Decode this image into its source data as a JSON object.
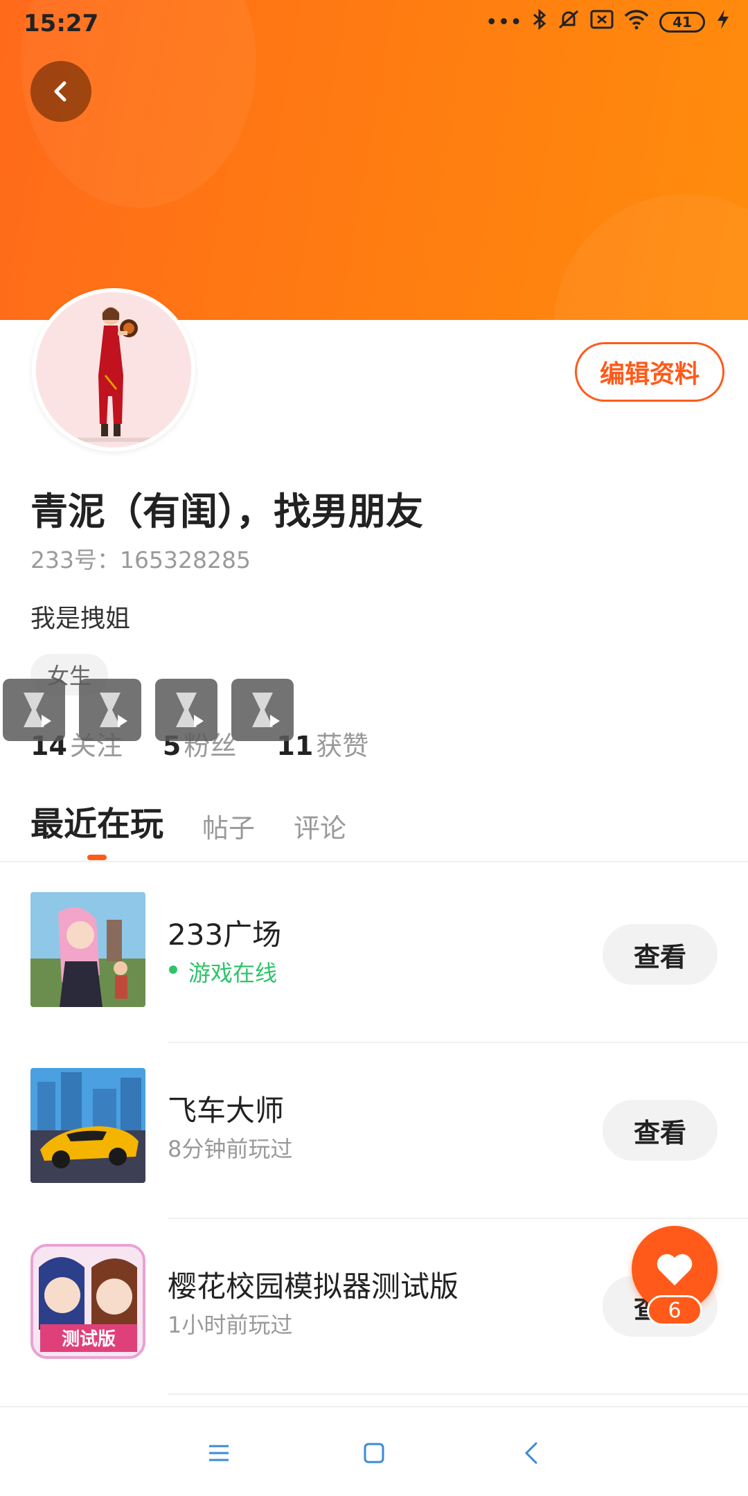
{
  "status_bar": {
    "time": "15:27",
    "battery": "41",
    "icons": [
      "more-dots-icon",
      "bluetooth-icon",
      "mute-icon",
      "sim-icon",
      "wifi-icon",
      "battery-icon",
      "charging-icon"
    ]
  },
  "profile": {
    "edit_label": "编辑资料",
    "nickname": "青泥（有闺），找男朋友",
    "id_text": "233号：165328285",
    "bio": "我是拽姐",
    "tag": "女生",
    "stats": [
      {
        "num": "14",
        "label": "关注"
      },
      {
        "num": "5",
        "label": "粉丝"
      },
      {
        "num": "11",
        "label": "获赞"
      }
    ]
  },
  "tabs": [
    {
      "label": "最近在玩",
      "active": true
    },
    {
      "label": "帖子",
      "active": false
    },
    {
      "label": "评论",
      "active": false
    }
  ],
  "games": [
    {
      "name": "233广场",
      "sub": "游戏在线",
      "online": true,
      "button": "查看"
    },
    {
      "name": "飞车大师",
      "sub": "8分钟前玩过",
      "online": false,
      "button": "查看"
    },
    {
      "name": "樱花校园模拟器测试版",
      "sub": "1小时前玩过",
      "online": false,
      "button": "查看",
      "thumb_badge": "测试版"
    }
  ],
  "like": {
    "count": "6"
  },
  "colors": {
    "accent": "#ff5a1a",
    "header": "#ff7a12",
    "online": "#2ec46a"
  }
}
